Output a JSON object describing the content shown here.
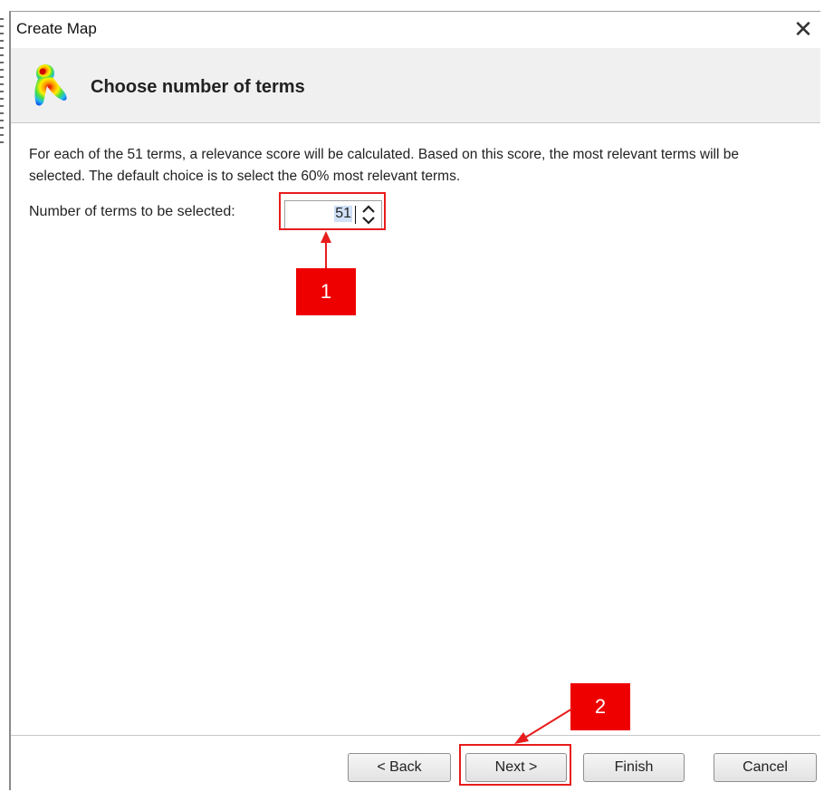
{
  "window": {
    "title": "Create Map",
    "close_symbol": "✕"
  },
  "header": {
    "title": "Choose number of terms",
    "icon": "heatmap-figure-icon"
  },
  "description": "For each of the 51 terms, a relevance score will be calculated. Based on this score, the most relevant terms will be selected. The default choice is to select the 60% most relevant terms.",
  "field": {
    "label": "Number of terms to be selected:",
    "value": "51"
  },
  "callouts": {
    "one": "1",
    "two": "2"
  },
  "buttons": {
    "back": "< Back",
    "next": "Next >",
    "finish": "Finish",
    "cancel": "Cancel"
  },
  "colors": {
    "annotation_red": "#e81c1c",
    "callout_red": "#ee0000"
  }
}
